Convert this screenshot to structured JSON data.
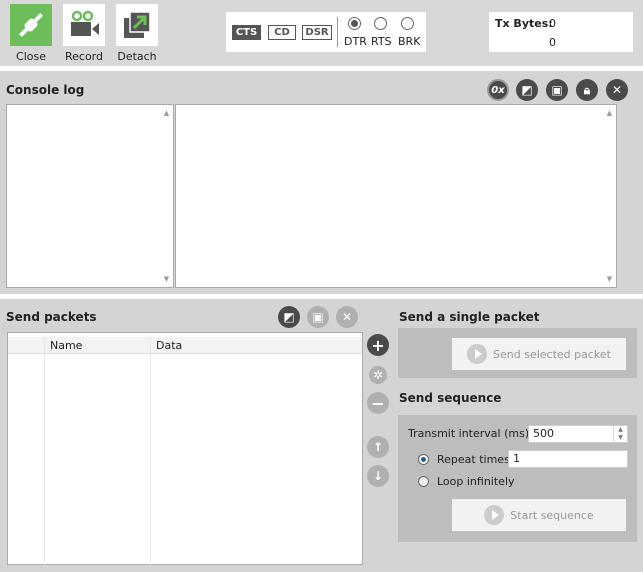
{
  "toolbar": {
    "close": "Close",
    "record": "Record",
    "detach": "Detach"
  },
  "signals": {
    "cts": "CTS",
    "cd": "CD",
    "dsr": "DSR",
    "dtr": "DTR",
    "rts": "RTS",
    "brk": "BRK"
  },
  "stats": {
    "tx_label": "Tx Bytes:",
    "tx_value": "0",
    "rx_value": "0"
  },
  "console": {
    "title": "Console log",
    "hex_label": "0x"
  },
  "packets": {
    "title": "Send packets",
    "columns": [
      "Name",
      "Data"
    ]
  },
  "single": {
    "title": "Send a single packet",
    "button": "Send selected packet"
  },
  "sequence": {
    "title": "Send sequence",
    "interval_label": "Transmit interval (ms):",
    "interval_value": "500",
    "repeat_label": "Repeat times",
    "repeat_value": "1",
    "loop_label": "Loop infinitely",
    "start_button": "Start sequence"
  },
  "colors": {
    "accent": "#6dbe5a"
  }
}
